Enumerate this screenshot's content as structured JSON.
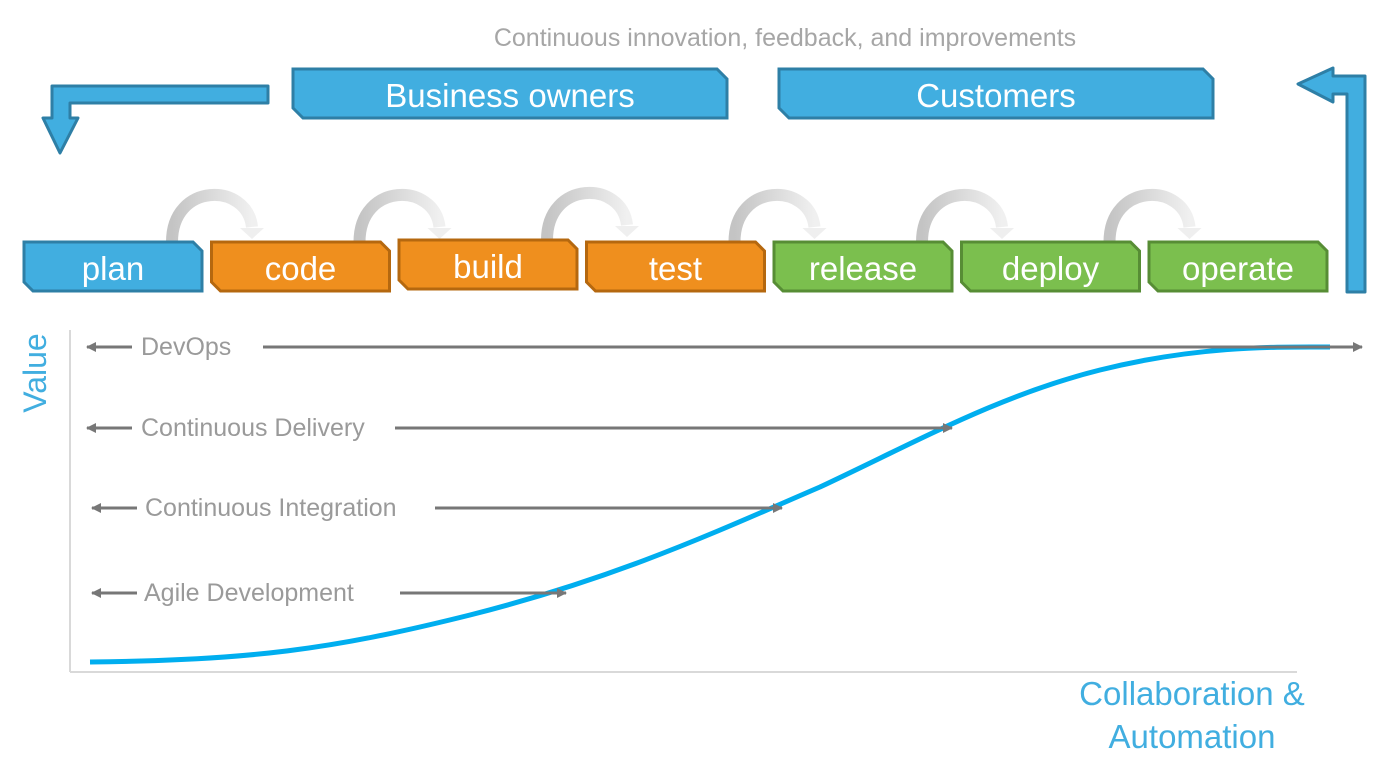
{
  "top_caption": "Continuous innovation, feedback, and improvements",
  "stakeholders": [
    {
      "label": "Business owners"
    },
    {
      "label": "Customers"
    }
  ],
  "stages": [
    {
      "label": "plan",
      "group": "blue"
    },
    {
      "label": "code",
      "group": "orange"
    },
    {
      "label": "build",
      "group": "orange"
    },
    {
      "label": "test",
      "group": "orange"
    },
    {
      "label": "release",
      "group": "green"
    },
    {
      "label": "deploy",
      "group": "green"
    },
    {
      "label": "operate",
      "group": "green"
    }
  ],
  "colors": {
    "blue": {
      "fill": "#41aee0",
      "stroke": "#2e7fa6"
    },
    "orange": {
      "fill": "#ef8f1e",
      "stroke": "#b5680f"
    },
    "green": {
      "fill": "#7bbf4e",
      "stroke": "#578d35"
    },
    "curve": "#00aeef",
    "axis_label": "#41aee0",
    "practice_text": "#9a9a9a",
    "practice_arrow": "#777777"
  },
  "y_axis_label": "Value",
  "x_axis_label": [
    "Collaboration &",
    "Automation"
  ],
  "practices": [
    {
      "label": "DevOps"
    },
    {
      "label": "Continuous Delivery"
    },
    {
      "label": "Continuous Integration"
    },
    {
      "label": "Agile Development"
    }
  ]
}
